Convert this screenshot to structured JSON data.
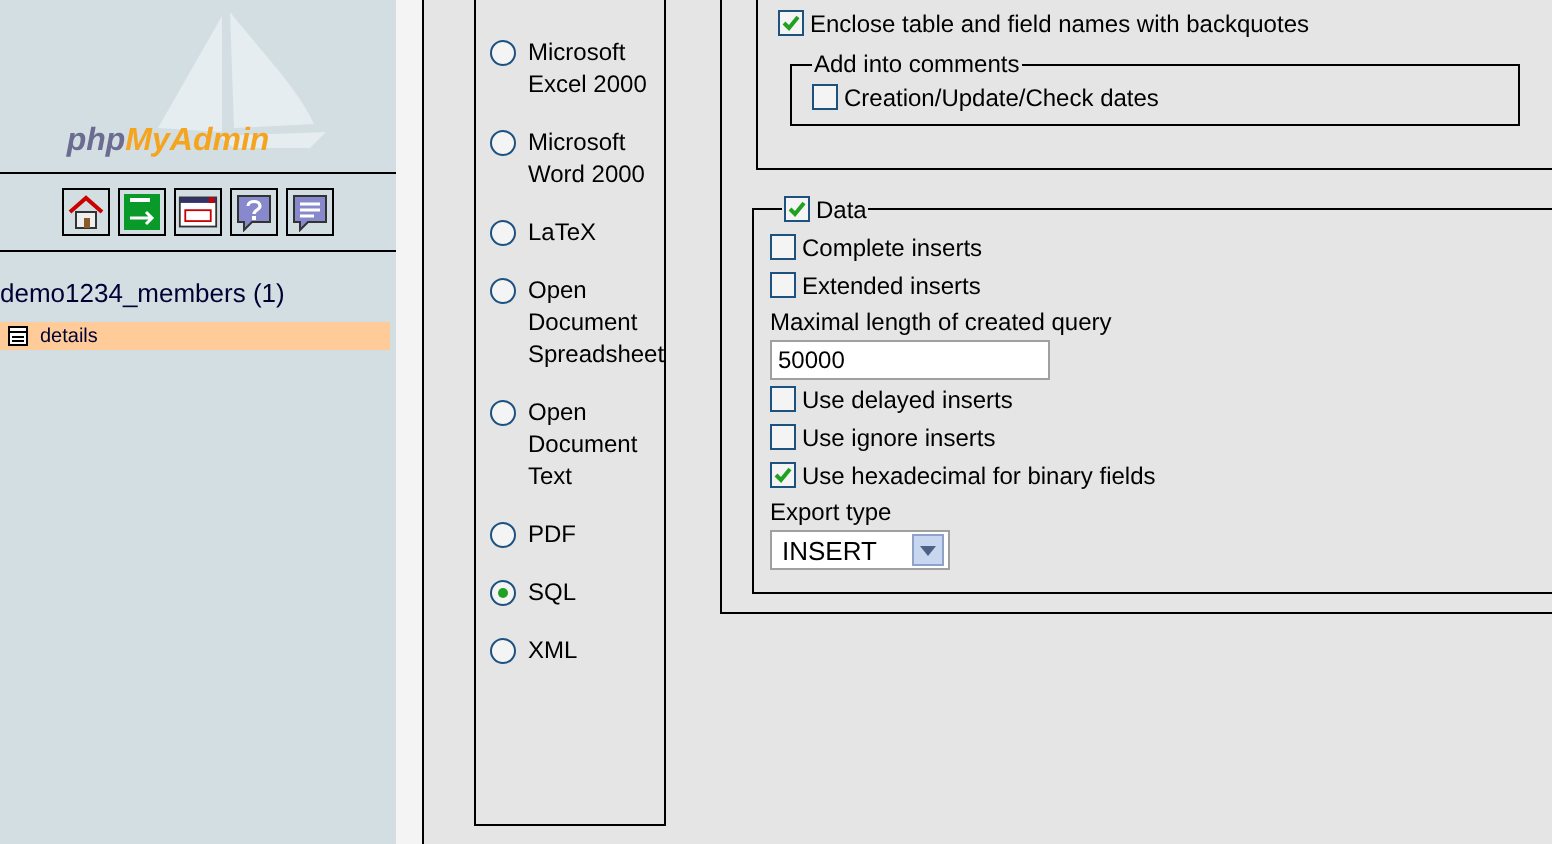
{
  "sidebar": {
    "logo": {
      "prefix": "php",
      "name": "MyAdmin"
    },
    "database": "demo1234_members (1)",
    "tables": [
      {
        "name": "details",
        "selected": true
      }
    ]
  },
  "formats": [
    {
      "label": "Microsoft Excel 2000",
      "selected": false
    },
    {
      "label": "Microsoft Word 2000",
      "selected": false
    },
    {
      "label": "LaTeX",
      "selected": false
    },
    {
      "label": "Open Document Spreadsheet",
      "selected": false
    },
    {
      "label": "Open Document Text",
      "selected": false
    },
    {
      "label": "PDF",
      "selected": false
    },
    {
      "label": "SQL",
      "selected": true
    },
    {
      "label": "XML",
      "selected": false
    }
  ],
  "structure": {
    "options": [
      {
        "label": "Enclose table and field names with backquotes",
        "checked": true
      }
    ],
    "comments": {
      "legend": "Add into comments",
      "options": [
        {
          "label": "Creation/Update/Check dates",
          "checked": false
        }
      ]
    }
  },
  "data": {
    "legend": {
      "label": "Data",
      "checked": true
    },
    "items": [
      {
        "kind": "checkbox",
        "label": "Complete inserts",
        "checked": false
      },
      {
        "kind": "checkbox",
        "label": "Extended inserts",
        "checked": false
      },
      {
        "kind": "field",
        "label": "Maximal length of created query",
        "value": "50000"
      },
      {
        "kind": "checkbox",
        "label": "Use delayed inserts",
        "checked": false
      },
      {
        "kind": "checkbox",
        "label": "Use ignore inserts",
        "checked": false
      },
      {
        "kind": "checkbox",
        "label": "Use hexadecimal for binary fields",
        "checked": true
      },
      {
        "kind": "select",
        "label": "Export type",
        "value": "INSERT"
      }
    ]
  }
}
